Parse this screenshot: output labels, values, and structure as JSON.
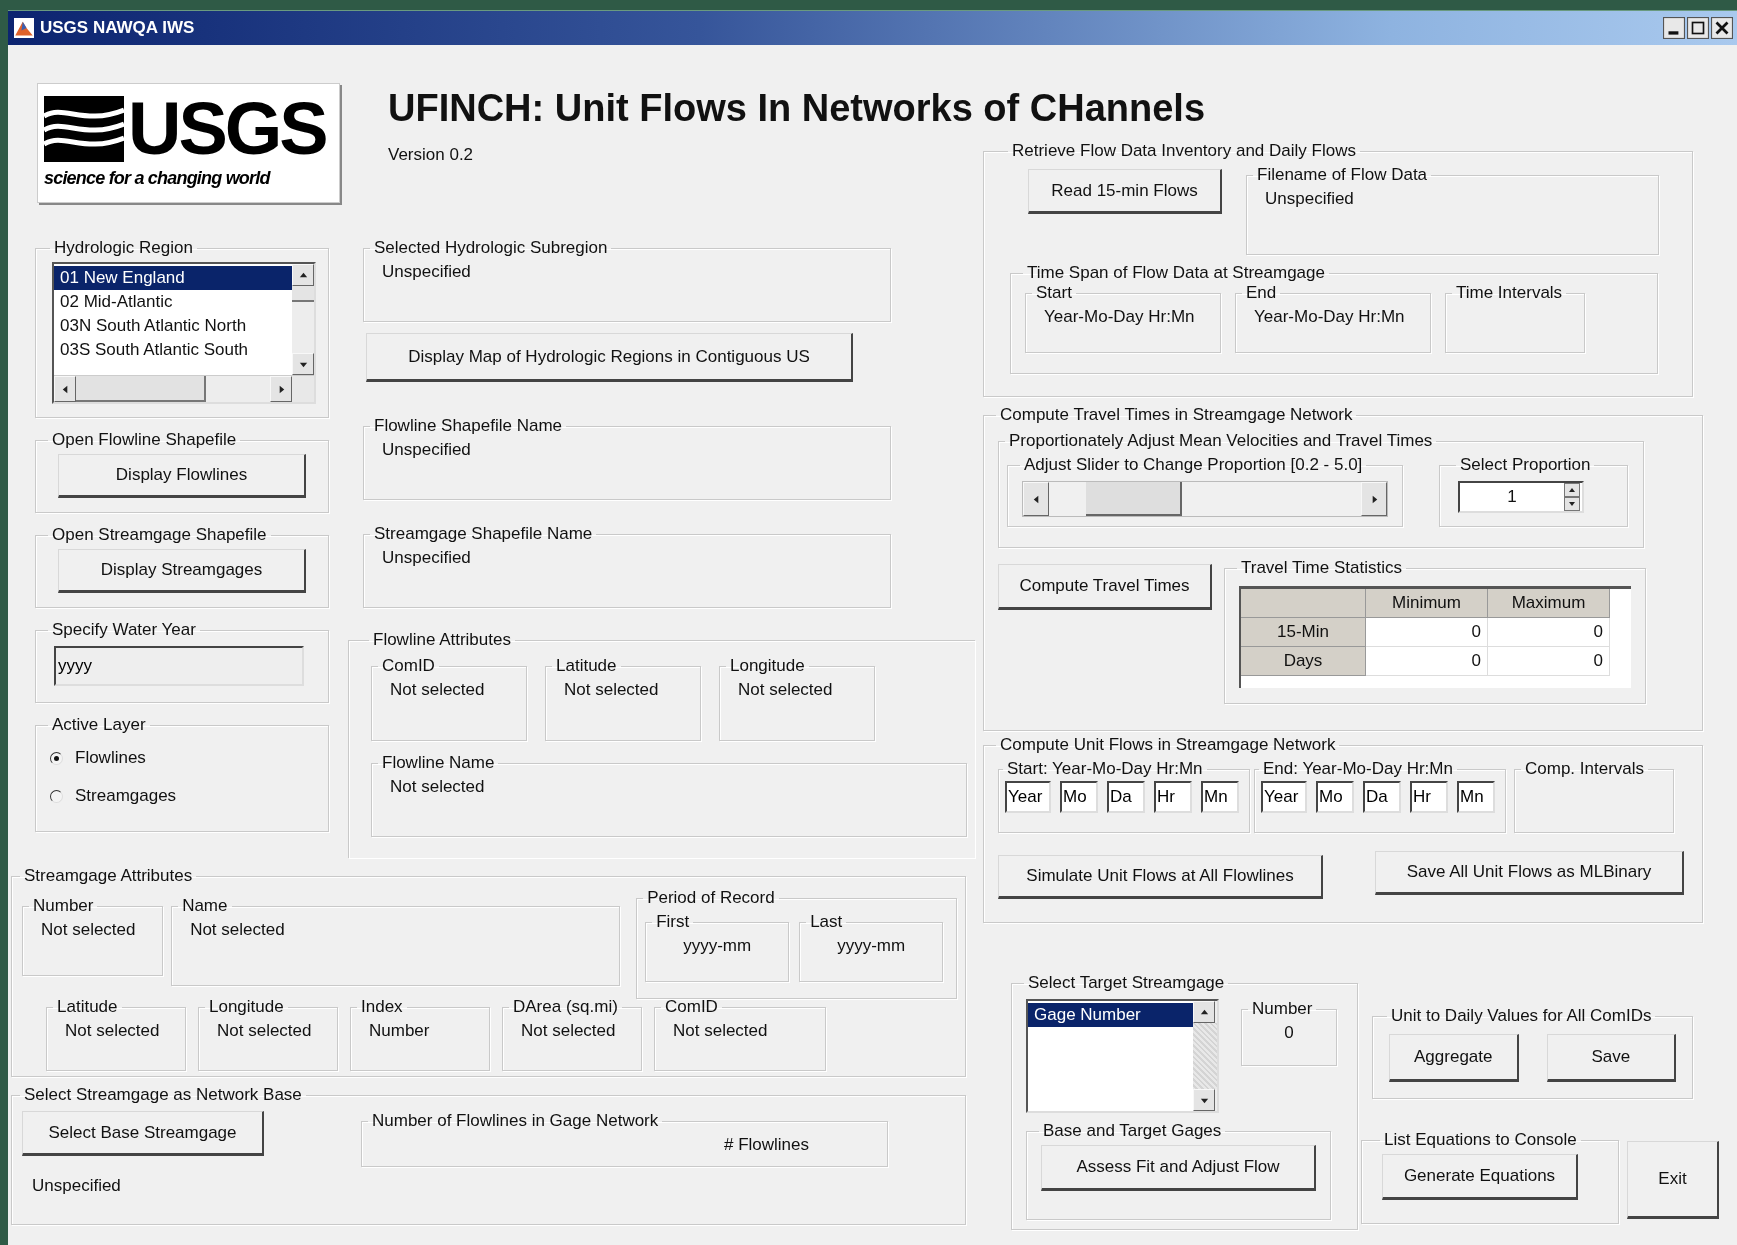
{
  "window": {
    "title": "USGS NAWQA IWS"
  },
  "logo": {
    "wordmark": "USGS",
    "tagline": "science for a changing world"
  },
  "app_title": "UFINCH: Unit Flows In Networks of CHannels",
  "version": "Version 0.2",
  "hydrologic_region": {
    "label": "Hydrologic Region",
    "items": [
      {
        "text": "01  New England",
        "selected": true
      },
      {
        "text": "02  Mid-Atlantic",
        "selected": false
      },
      {
        "text": "03N South Atlantic North",
        "selected": false
      },
      {
        "text": "03S South Atlantic South",
        "selected": false
      }
    ]
  },
  "selected_subregion": {
    "label": "Selected Hydrologic Subregion",
    "value": "Unspecified"
  },
  "map_button": "Display Map of Hydrologic Regions in Contiguous US",
  "flowline_shapefile": {
    "label": "Open Flowline Shapefile",
    "button": "Display Flowlines"
  },
  "flowline_shapefile_name": {
    "label": "Flowline Shapefile Name",
    "value": "Unspecified"
  },
  "streamgage_shapefile": {
    "label": "Open Streamgage Shapefile",
    "button": "Display Streamgages"
  },
  "streamgage_shapefile_name": {
    "label": "Streamgage Shapefile Name",
    "value": "Unspecified"
  },
  "water_year": {
    "label": "Specify Water Year",
    "value": "yyyy"
  },
  "active_layer": {
    "label": "Active Layer",
    "options": [
      {
        "label": "Flowlines",
        "selected": true
      },
      {
        "label": "Streamgages",
        "selected": false
      }
    ]
  },
  "flowline_attributes": {
    "label": "Flowline Attributes",
    "fields": [
      {
        "label": "ComID",
        "value": "Not selected"
      },
      {
        "label": "Latitude",
        "value": "Not selected"
      },
      {
        "label": "Longitude",
        "value": "Not selected"
      }
    ],
    "name": {
      "label": "Flowline Name",
      "value": "Not selected"
    }
  },
  "streamgage_attributes": {
    "label": "Streamgage Attributes",
    "number": {
      "label": "Number",
      "value": "Not selected"
    },
    "name": {
      "label": "Name",
      "value": "Not selected"
    },
    "period_of_record": {
      "label": "Period of Record",
      "first": {
        "label": "First",
        "value": "yyyy-mm"
      },
      "last": {
        "label": "Last",
        "value": "yyyy-mm"
      }
    },
    "fields": [
      {
        "label": "Latitude",
        "value": "Not selected"
      },
      {
        "label": "Longitude",
        "value": "Not selected"
      },
      {
        "label": "Index",
        "value": "Number"
      },
      {
        "label": "DArea (sq.mi)",
        "value": "Not selected"
      },
      {
        "label": "ComID",
        "value": "Not selected"
      }
    ]
  },
  "network_base": {
    "label": "Select Streamgage as Network Base",
    "button": "Select Base Streamgage",
    "status": "Unspecified",
    "flowline_count": {
      "label": "Number of Flowlines in Gage Network",
      "value": "# Flowlines"
    }
  },
  "retrieve": {
    "label": "Retrieve Flow Data Inventory and Daily Flows",
    "button": "Read 15-min Flows",
    "filename": {
      "label": "Filename of Flow Data",
      "value": "Unspecified"
    },
    "time_span": {
      "label": "Time Span of Flow Data at Streamgage",
      "fields": [
        {
          "label": "Start",
          "value": "Year-Mo-Day Hr:Mn"
        },
        {
          "label": "End",
          "value": "Year-Mo-Day Hr:Mn"
        },
        {
          "label": "Time Intervals"
        }
      ]
    }
  },
  "travel_times": {
    "label": "Compute Travel Times in Streamgage Network",
    "adjust": {
      "label": "Proportionately Adjust Mean Velocities and Travel Times",
      "slider": {
        "label": "Adjust Slider to Change Proportion [0.2 - 5.0]",
        "level": 0.17
      },
      "proportion": {
        "label": "Select Proportion",
        "value": "1"
      }
    },
    "button": "Compute Travel Times",
    "stats": {
      "label": "Travel Time Statistics",
      "columns": [
        "Minimum",
        "Maximum"
      ],
      "rows": [
        {
          "header": "15-Min",
          "values": [
            "0",
            "0"
          ]
        },
        {
          "header": "Days",
          "values": [
            "0",
            "0"
          ]
        }
      ]
    }
  },
  "unit_flows": {
    "label": "Compute Unit Flows in Streamgage Network",
    "start": {
      "label": "Start: Year-Mo-Day Hr:Mn",
      "fields": [
        "Year",
        "Mo",
        "Da",
        "Hr",
        "Mn"
      ]
    },
    "end": {
      "label": "End: Year-Mo-Day Hr:Mn",
      "fields": [
        "Year",
        "Mo",
        "Da",
        "Hr",
        "Mn"
      ]
    },
    "intervals": {
      "label": "Comp. Intervals"
    },
    "simulate_button": "Simulate Unit Flows at All Flowlines",
    "save_button": "Save All Unit Flows as MLBinary"
  },
  "target": {
    "label": "Select Target Streamgage",
    "items": [
      {
        "text": "Gage Number",
        "selected": true
      }
    ],
    "number": {
      "label": "Number",
      "value": "0"
    },
    "gages": {
      "label": "Base and Target Gages",
      "button": "Assess Fit and Adjust Flow"
    }
  },
  "daily": {
    "label": "Unit to Daily Values for All ComIDs",
    "buttons": [
      "Aggregate",
      "Save"
    ]
  },
  "equations": {
    "label": "List Equations to Console",
    "button": "Generate Equations"
  },
  "exit_button": "Exit"
}
